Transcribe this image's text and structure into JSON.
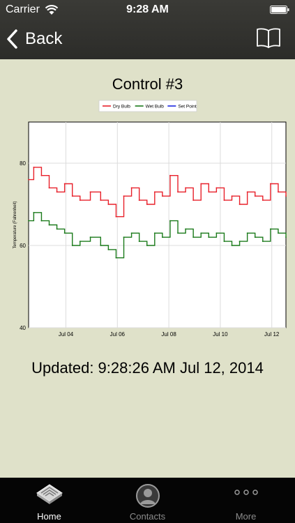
{
  "status_bar": {
    "carrier": "Carrier",
    "time": "9:28 AM"
  },
  "nav": {
    "back_label": "Back"
  },
  "page_title": "Control #3",
  "updated_text": "Updated: 9:28:26 AM Jul 12, 2014",
  "tabs": [
    {
      "label": "Home",
      "active": true
    },
    {
      "label": "Contacts",
      "active": false
    },
    {
      "label": "More",
      "active": false
    }
  ],
  "chart_data": {
    "type": "line",
    "ylabel": "Temperature (Fahrenheit)",
    "xlabel": "",
    "ylim": [
      40,
      90
    ],
    "xlim": [
      0,
      100
    ],
    "yticks": [
      40,
      60,
      80
    ],
    "xticks": [
      {
        "x": 14.5,
        "label": "Jul 04"
      },
      {
        "x": 34.5,
        "label": "Jul 06"
      },
      {
        "x": 54.5,
        "label": "Jul 08"
      },
      {
        "x": 74.5,
        "label": "Jul 10"
      },
      {
        "x": 94.5,
        "label": "Jul 12"
      }
    ],
    "grid": true,
    "legend_position": "top-center",
    "series": [
      {
        "name": "Dry Bulb",
        "color": "#e8202a",
        "x": [
          0,
          2,
          5,
          8,
          11,
          14,
          17,
          20,
          24,
          28,
          31,
          34,
          37,
          40,
          43,
          46,
          49,
          52,
          55,
          58,
          61,
          64,
          67,
          70,
          73,
          76,
          79,
          82,
          85,
          88,
          91,
          94,
          97,
          100
        ],
        "y": [
          76,
          79,
          77,
          74,
          73,
          75,
          72,
          71,
          73,
          71,
          70,
          67,
          72,
          74,
          71,
          70,
          73,
          72,
          77,
          73,
          74,
          71,
          75,
          73,
          74,
          71,
          72,
          70,
          73,
          72,
          71,
          75,
          73,
          72
        ]
      },
      {
        "name": "Wet Bulb",
        "color": "#1a7a1a",
        "x": [
          0,
          2,
          5,
          8,
          11,
          14,
          17,
          20,
          24,
          28,
          31,
          34,
          37,
          40,
          43,
          46,
          49,
          52,
          55,
          58,
          61,
          64,
          67,
          70,
          73,
          76,
          79,
          82,
          85,
          88,
          91,
          94,
          97,
          100
        ],
        "y": [
          66,
          68,
          66,
          65,
          64,
          63,
          60,
          61,
          62,
          60,
          59,
          57,
          62,
          63,
          61,
          60,
          63,
          62,
          66,
          63,
          64,
          62,
          63,
          62,
          63,
          61,
          60,
          61,
          63,
          62,
          61,
          64,
          63,
          62
        ]
      },
      {
        "name": "Set Point",
        "color": "#1a25e0",
        "x": [],
        "y": []
      }
    ]
  }
}
